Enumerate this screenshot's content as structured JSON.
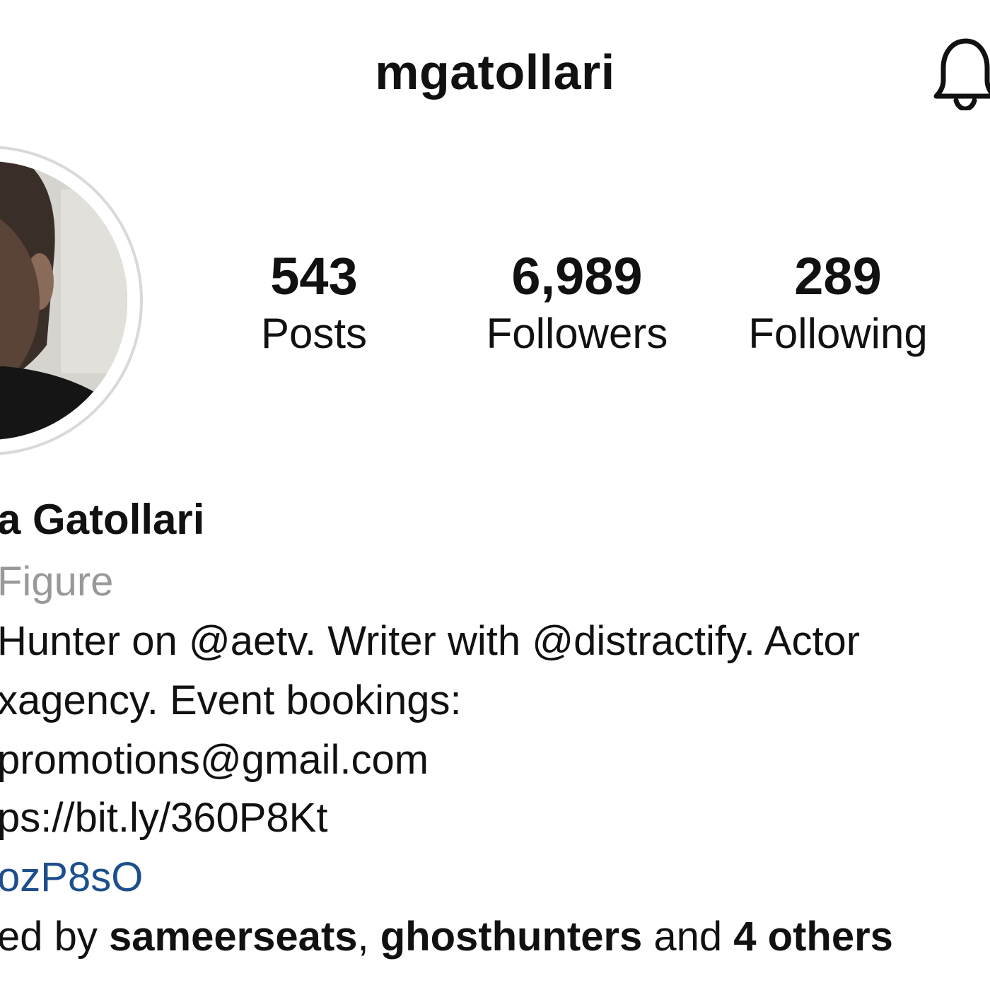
{
  "header": {
    "username": "mgatollari",
    "bell_icon": "bell-icon"
  },
  "profile": {
    "avatar_icon": "profile-photo"
  },
  "stats": {
    "posts": {
      "value": "543",
      "label": "Posts"
    },
    "followers": {
      "value": "6,989",
      "label": "Followers"
    },
    "following": {
      "value": "289",
      "label": "Following"
    }
  },
  "bio": {
    "name": "a Gatollari",
    "category": "Figure",
    "line1": "Hunter on @aetv. Writer with @distractify. Actor",
    "line2": "xagency. Event bookings:",
    "line3": "promotions@gmail.com",
    "line4": "ps://bit.ly/360P8Kt",
    "link": "ozP8sO"
  },
  "followed_by": {
    "prefix": "ed by ",
    "user1": "sameerseats",
    "sep": ", ",
    "user2": "ghosthunters",
    "and": " and ",
    "others": "4 others"
  },
  "colors": {
    "text": "#111111",
    "secondary": "#999999",
    "link": "#1d4f8c",
    "ring": "#d9d9d9"
  }
}
